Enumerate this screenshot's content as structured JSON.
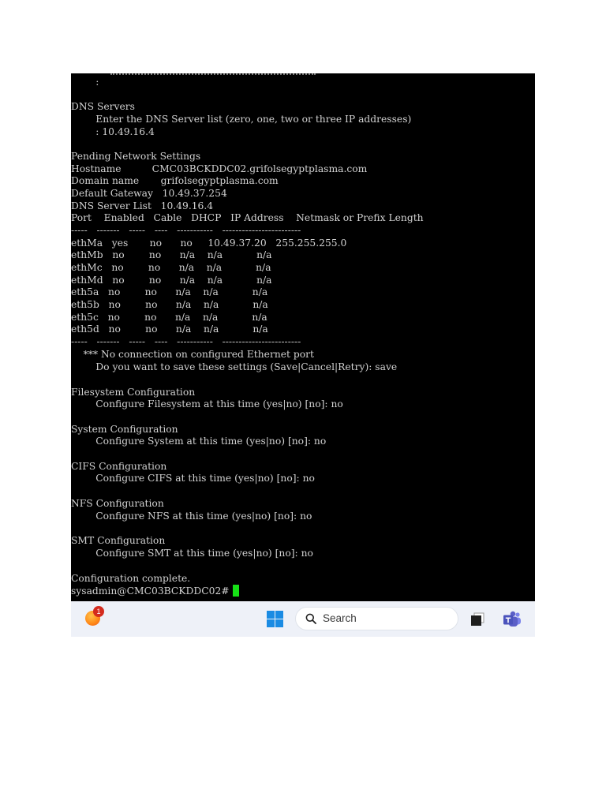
{
  "terminal": {
    "lines": [
      "        :",
      "",
      "DNS Servers",
      "        Enter the DNS Server list (zero, one, two or three IP addresses)",
      "        : 10.49.16.4",
      "",
      "Pending Network Settings",
      "Hostname          CMC03BCKDDC02.grifolsegyptplasma.com",
      "Domain name       grifolsegyptplasma.com",
      "Default Gateway   10.49.37.254",
      "DNS Server List   10.49.16.4",
      "Port    Enabled   Cable   DHCP   IP Address    Netmask or Prefix Length",
      "-----   -------   -----   ----   -----------   ------------------------",
      "ethMa   yes       no      no     10.49.37.20   255.255.255.0",
      "ethMb   no        no      n/a    n/a           n/a",
      "ethMc   no        no      n/a    n/a           n/a",
      "ethMd   no        no      n/a    n/a           n/a",
      "eth5a   no        no      n/a    n/a           n/a",
      "eth5b   no        no      n/a    n/a           n/a",
      "eth5c   no        no      n/a    n/a           n/a",
      "eth5d   no        no      n/a    n/a           n/a",
      "-----   -------   -----   ----   -----------   ------------------------",
      "    *** No connection on configured Ethernet port",
      "        Do you want to save these settings (Save|Cancel|Retry): save",
      "",
      "Filesystem Configuration",
      "        Configure Filesystem at this time (yes|no) [no]: no",
      "",
      "System Configuration",
      "        Configure System at this time (yes|no) [no]: no",
      "",
      "CIFS Configuration",
      "        Configure CIFS at this time (yes|no) [no]: no",
      "",
      "NFS Configuration",
      "        Configure NFS at this time (yes|no) [no]: no",
      "",
      "SMT Configuration",
      "        Configure SMT at this time (yes|no) [no]: no",
      "",
      "Configuration complete.",
      "sysadmin@CMC03BCKDDC02# "
    ],
    "colors": {
      "background": "#000000",
      "text": "#d2d2d2",
      "cursor": "#16e016"
    }
  },
  "taskbar": {
    "notification_count": "1",
    "search_label": "Search",
    "icons": [
      "notification-app-icon",
      "windows-start-icon",
      "search-icon",
      "task-view-icon",
      "teams-icon"
    ],
    "colors": {
      "background": "#eef1f8",
      "start": "#1a8be3",
      "teams": "#5b5fc7",
      "badge": "#d42b1e"
    }
  }
}
